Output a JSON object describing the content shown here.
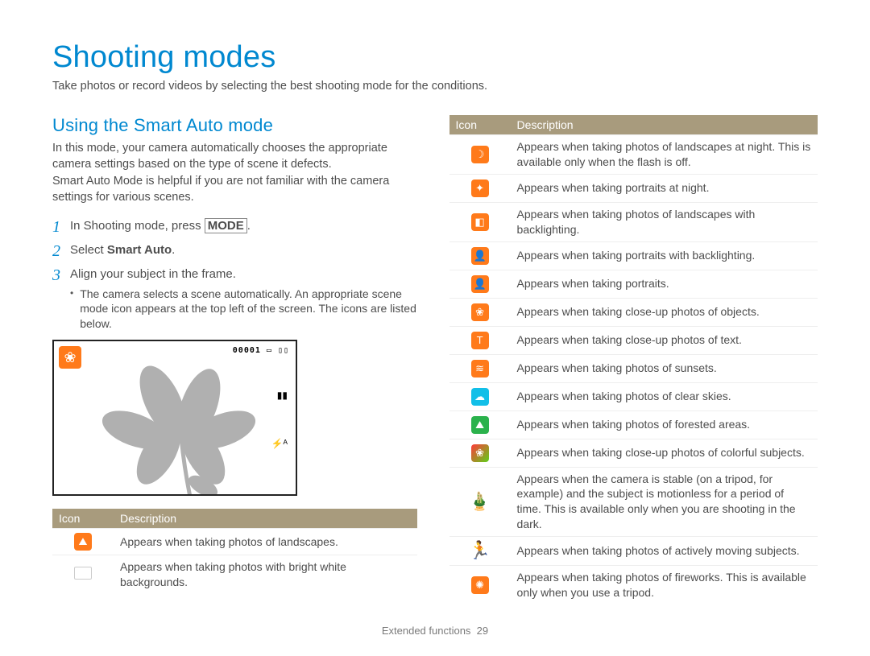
{
  "title": "Shooting modes",
  "intro": "Take photos or record videos by selecting the best shooting mode for the conditions.",
  "section_heading": "Using the Smart Auto mode",
  "desc_line1": "In this mode, your camera automatically chooses the appropriate camera settings based on the type of scene it defects.",
  "desc_line2": "Smart Auto Mode is helpful if you are not familiar with the camera settings for various scenes.",
  "steps": {
    "s1_pre": "In Shooting mode, press ",
    "s1_key": "MODE",
    "s1_post": ".",
    "s2_pre": "Select ",
    "s2_bold": "Smart Auto",
    "s2_post": ".",
    "s3": "Align your subject in the frame.",
    "s3_bullet": "The camera selects a scene automatically. An appropriate scene mode icon appears at the top left of the screen. The icons are listed below."
  },
  "lcd_counter": "00001",
  "table_headers": {
    "icon": "Icon",
    "desc": "Description"
  },
  "left_rows": [
    {
      "icon_name": "landscape-icon",
      "glyph": "⛰",
      "cls": "ic-orange",
      "desc": "Appears when taking photos of landscapes."
    },
    {
      "icon_name": "white-bg-icon",
      "glyph": "",
      "cls": "ic-white",
      "desc": "Appears when taking photos with bright white backgrounds."
    }
  ],
  "right_rows": [
    {
      "icon_name": "night-landscape-icon",
      "glyph": "☽",
      "cls": "ic-orange",
      "desc": "Appears when taking photos of landscapes at night. This is available only when the flash is off."
    },
    {
      "icon_name": "night-portrait-icon",
      "glyph": "✦",
      "cls": "ic-orange",
      "desc": "Appears when taking portraits at night."
    },
    {
      "icon_name": "backlight-landscape-icon",
      "glyph": "◧",
      "cls": "ic-orange",
      "desc": "Appears when taking photos of landscapes with backlighting."
    },
    {
      "icon_name": "backlight-portrait-icon",
      "glyph": "👤",
      "cls": "ic-orange",
      "desc": "Appears when taking portraits with backlighting."
    },
    {
      "icon_name": "portrait-icon",
      "glyph": "👤",
      "cls": "ic-orange",
      "desc": "Appears when taking portraits."
    },
    {
      "icon_name": "macro-icon",
      "glyph": "❀",
      "cls": "ic-orange",
      "desc": "Appears when taking close-up photos of objects."
    },
    {
      "icon_name": "macro-text-icon",
      "glyph": "T",
      "cls": "ic-orange",
      "desc": "Appears when taking close-up photos of text."
    },
    {
      "icon_name": "sunset-icon",
      "glyph": "≋",
      "cls": "ic-orange",
      "desc": "Appears when taking photos of sunsets."
    },
    {
      "icon_name": "sky-icon",
      "glyph": "☁",
      "cls": "ic-blue",
      "desc": "Appears when taking photos of clear skies."
    },
    {
      "icon_name": "forest-icon",
      "glyph": "⛰",
      "cls": "ic-green",
      "desc": "Appears when taking photos of forested areas."
    },
    {
      "icon_name": "macro-color-icon",
      "glyph": "❀",
      "cls": "ic-gradient",
      "desc": "Appears when taking close-up photos of colorful subjects."
    },
    {
      "icon_name": "tripod-icon",
      "glyph": "🎍",
      "cls": "",
      "special": "stickman",
      "desc": "Appears when the camera is stable (on a tripod, for example) and the subject is motionless for a period of time. This is available only when you are shooting in the dark."
    },
    {
      "icon_name": "action-icon",
      "glyph": "🏃",
      "cls": "",
      "special": "stickman",
      "desc": "Appears when taking photos of actively moving subjects."
    },
    {
      "icon_name": "fireworks-icon",
      "glyph": "✺",
      "cls": "ic-orange",
      "desc": "Appears when taking photos of fireworks. This is available only when you use a tripod."
    }
  ],
  "footer_label": "Extended functions",
  "footer_page": "29"
}
